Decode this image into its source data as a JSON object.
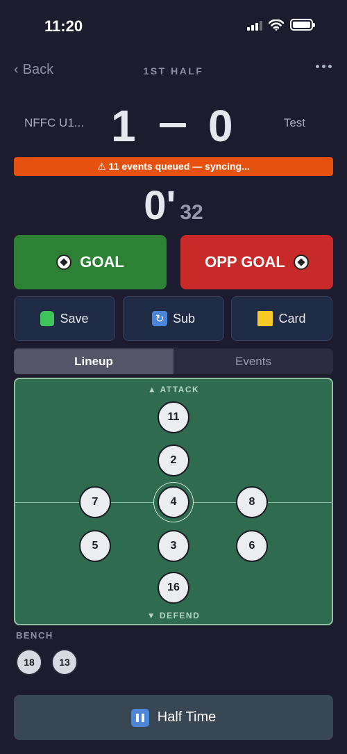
{
  "status_bar": {
    "time": "11:20"
  },
  "nav": {
    "back_label": "Back",
    "period": "1ST HALF"
  },
  "scoreboard": {
    "home_team": "NFFC U1...",
    "home_score": "1",
    "away_team": "Test",
    "away_score": "0"
  },
  "sync_banner": {
    "text": "⚠ 11 events queued — syncing..."
  },
  "clock": {
    "minutes": "0'",
    "seconds": "32"
  },
  "actions": {
    "goal_label": "GOAL",
    "opp_goal_label": "OPP GOAL",
    "save_label": "Save",
    "sub_label": "Sub",
    "card_label": "Card"
  },
  "tabs": [
    {
      "label": "Lineup",
      "active": true
    },
    {
      "label": "Events",
      "active": false
    }
  ],
  "pitch": {
    "attack_label": "▲ ATTACK",
    "defend_label": "▼ DEFEND",
    "players": {
      "p11": "11",
      "p2": "2",
      "p7": "7",
      "p4": "4",
      "p8": "8",
      "p5": "5",
      "p3": "3",
      "p6": "6",
      "p16": "16"
    },
    "selected_player": "4"
  },
  "bench": {
    "title": "BENCH",
    "players": [
      "18",
      "13"
    ]
  },
  "half_time": {
    "label": "Half Time"
  },
  "colors": {
    "background": "#1c1c2e",
    "goal": "#2d8134",
    "opp_goal": "#c82a2a",
    "sync_banner": "#e5510e",
    "pitch": "#2e6b4f"
  },
  "icons": {
    "goal": "soccer-ball-icon",
    "save": "goalkeeper-glove-icon",
    "sub": "substitution-cycle-icon",
    "card": "yellow-card-icon",
    "half_time": "pause-icon"
  }
}
